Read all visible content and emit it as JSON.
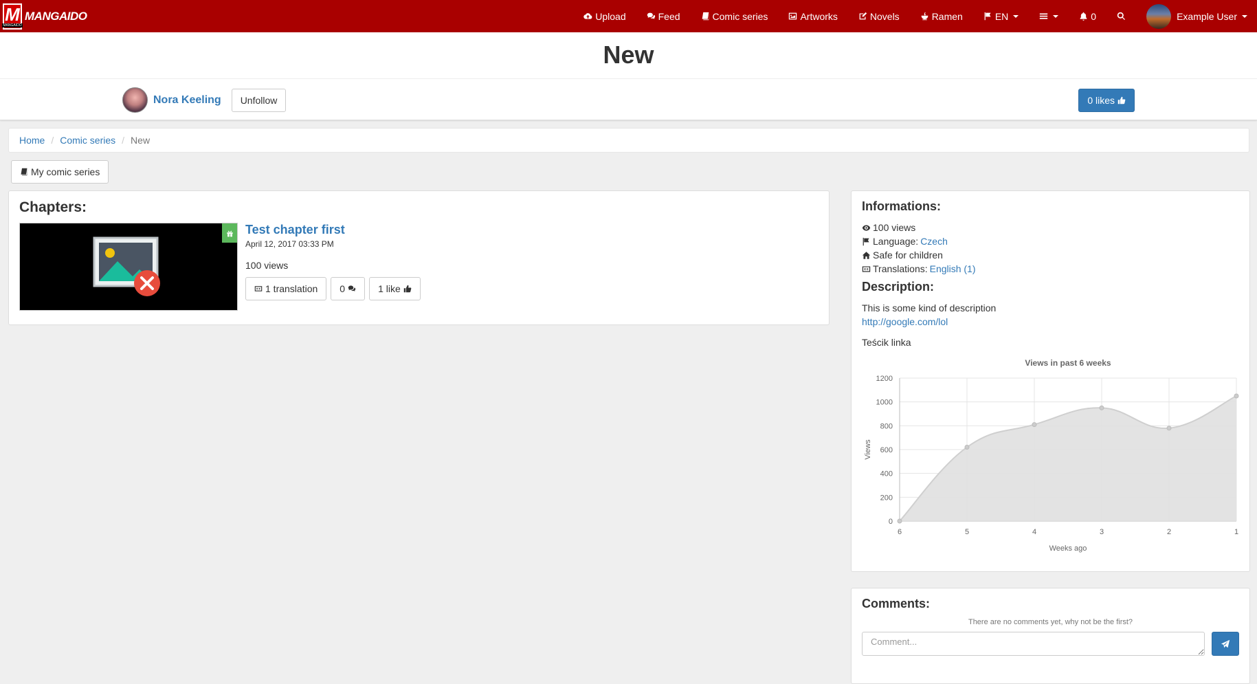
{
  "brand": {
    "letter": "M",
    "small": "MANGAIDO",
    "name": "MANGAIDO"
  },
  "nav": {
    "upload": "Upload",
    "feed": "Feed",
    "comic_series": "Comic series",
    "artworks": "Artworks",
    "novels": "Novels",
    "ramen": "Ramen",
    "language": "EN",
    "notifications": "0",
    "user": "Example User"
  },
  "page": {
    "title": "New"
  },
  "author": {
    "name": "Nora Keeling",
    "unfollow_label": "Unfollow",
    "likes_label": "0 likes"
  },
  "breadcrumb": {
    "home": "Home",
    "comic_series": "Comic series",
    "current": "New"
  },
  "my_comics_label": "My comic series",
  "chapters": {
    "heading": "Chapters:",
    "items": [
      {
        "title": "Test chapter first",
        "date": "April 12, 2017 03:33 PM",
        "views": "100 views",
        "translations": "1 translation",
        "comments": "0",
        "likes": "1 like"
      }
    ]
  },
  "info": {
    "heading": "Informations:",
    "views": "100 views",
    "language_label": "Language:",
    "language": "Czech",
    "safe": "Safe for children",
    "translations_label": "Translations:",
    "translations": "English (1)",
    "description_heading": "Description:",
    "description_text": "This is some kind of description",
    "description_link": "http://google.com/lol",
    "description_extra": "Teścik linka"
  },
  "chart_data": {
    "type": "area",
    "title": "Views in past 6 weeks",
    "xlabel": "Weeks ago",
    "ylabel": "Views",
    "categories": [
      "6",
      "5",
      "4",
      "3",
      "2",
      "1"
    ],
    "values": [
      0,
      620,
      810,
      950,
      780,
      1050
    ],
    "ylim": [
      0,
      1200
    ],
    "yticks": [
      0,
      200,
      400,
      600,
      800,
      1000,
      1200
    ],
    "grid": true,
    "fill_color": "#e0e0e0",
    "line_color": "#cfcfcf"
  },
  "comments": {
    "heading": "Comments:",
    "empty_text": "There are no comments yet, why not be the first?",
    "placeholder": "Comment..."
  },
  "colors": {
    "navbar": "#a90000",
    "primary": "#337ab7",
    "success": "#5cb85c"
  }
}
